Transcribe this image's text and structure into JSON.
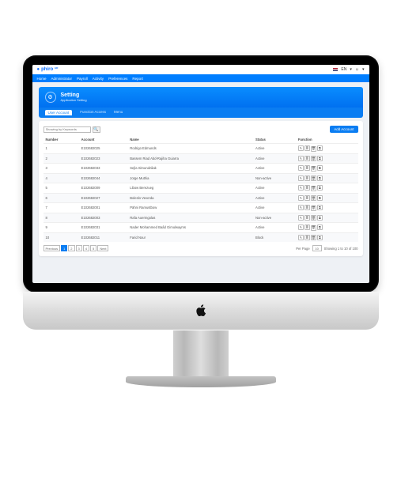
{
  "brand": {
    "name": "phiro",
    "suffix": "HR",
    "logo_icon": "●"
  },
  "header": {
    "lang_label": "EN",
    "user_icon": "user"
  },
  "nav": {
    "items": [
      "Home",
      "Administrator",
      "Payroll",
      "Activity",
      "Preferences",
      "Report"
    ]
  },
  "page": {
    "title": "Setting",
    "subtitle": "Application Setting"
  },
  "tabs": {
    "items": [
      {
        "label": "User Account",
        "active": true
      },
      {
        "label": "Function Access",
        "active": false
      },
      {
        "label": "Menu",
        "active": false
      }
    ]
  },
  "toolbar": {
    "search_placeholder": "Showing by Keywords",
    "add_label": "Add Account"
  },
  "table": {
    "columns": [
      "Number",
      "Account",
      "Name",
      "Status",
      "Function"
    ],
    "rows": [
      {
        "n": "1",
        "account": "E102682025",
        "name": "Rodrigo Edmunds",
        "status": "Active"
      },
      {
        "n": "2",
        "account": "E102682023",
        "name": "Bassem Riad Abd-Rajiha Guiarra",
        "status": "Active"
      },
      {
        "n": "3",
        "account": "E102682033",
        "name": "Sejla Simundzâak",
        "status": "Active"
      },
      {
        "n": "4",
        "account": "E102682044",
        "name": "Jorge Muthia",
        "status": "Non-active"
      },
      {
        "n": "5",
        "account": "E102682009",
        "name": "Libow Berezueg",
        "status": "Active"
      },
      {
        "n": "6",
        "account": "E102682027",
        "name": "Boleslo Veverda",
        "status": "Active"
      },
      {
        "n": "7",
        "account": "E102682001",
        "name": "Pähni Ramustbow",
        "status": "Active"
      },
      {
        "n": "8",
        "account": "E102682003",
        "name": "Rafa Auermgolas",
        "status": "Non-active"
      },
      {
        "n": "9",
        "account": "E102682031",
        "name": "Nader Mohammed Baâd Gimulwayms",
        "status": "Active"
      },
      {
        "n": "10",
        "account": "E102682011",
        "name": "Farid Nour",
        "status": "Block"
      }
    ]
  },
  "pagination": {
    "prev": "Previous",
    "pages": [
      "1",
      "2",
      "3",
      "4",
      "5"
    ],
    "next": "Next",
    "perpage_label": "Per Page",
    "perpage_value": "10",
    "summary": "Showing 1 to 10 of 100"
  },
  "colors": {
    "primary": "#0a7df2"
  }
}
